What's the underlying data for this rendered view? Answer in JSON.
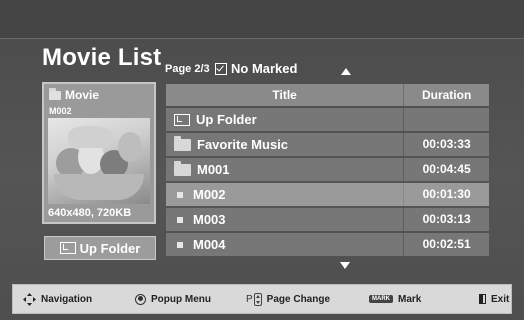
{
  "header": {
    "title": "Movie List",
    "page_info": "Page 2/3",
    "marked_label": "No Marked"
  },
  "preview": {
    "type_label": "Movie",
    "file_name": "M002",
    "resolution": "640x480, 720KB"
  },
  "up_folder_button": {
    "label": "Up Folder"
  },
  "list": {
    "columns": {
      "title": "Title",
      "duration": "Duration"
    },
    "rows": [
      {
        "name": "Up Folder",
        "duration": "",
        "icon": "up-folder-icon"
      },
      {
        "name": "Favorite Music",
        "duration": "00:03:33",
        "icon": "folder-icon"
      },
      {
        "name": "M001",
        "duration": "00:04:45",
        "icon": "folder-icon"
      },
      {
        "name": "M002",
        "duration": "00:01:30",
        "icon": "file-icon",
        "selected": true
      },
      {
        "name": "M003",
        "duration": "00:03:13",
        "icon": "file-icon"
      },
      {
        "name": "M004",
        "duration": "00:02:51",
        "icon": "file-icon"
      }
    ]
  },
  "footer": {
    "navigation": "Navigation",
    "popup_menu": "Popup Menu",
    "page_prefix": "P",
    "page_change": "Page Change",
    "mark_badge": "MARK",
    "mark": "Mark",
    "exit": "Exit"
  },
  "colors": {
    "background": "#4e4e4e",
    "row": "#777777",
    "row_selected": "#9a9a9a",
    "footer": "#d9d9d9"
  }
}
